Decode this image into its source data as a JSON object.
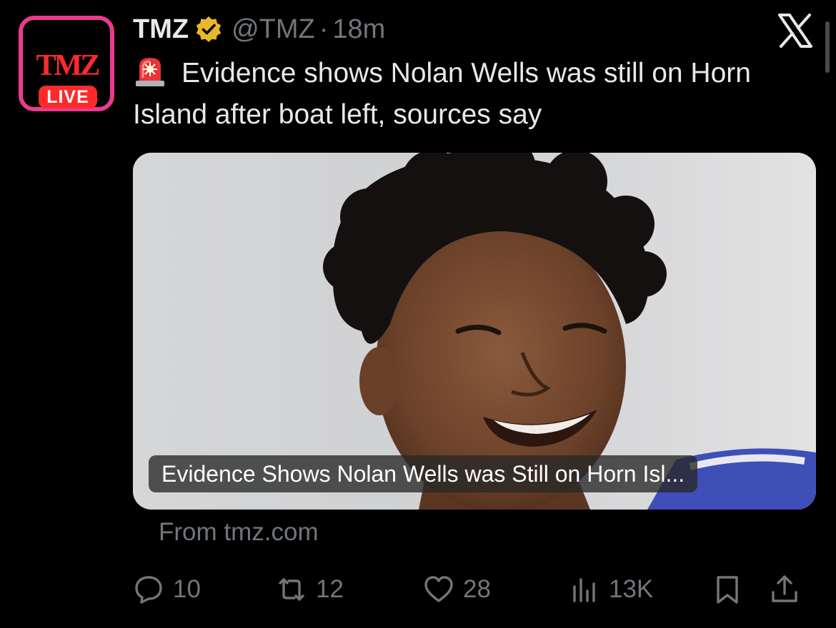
{
  "author": {
    "avatar": {
      "logo_text": "TMZ",
      "live_label": "LIVE",
      "border_color": "#ea3b8d",
      "logo_color": "#ff2a2a"
    },
    "display_name": "TMZ",
    "verified_icon": "gold-verified-badge-icon",
    "handle": "@TMZ",
    "separator": "·",
    "time": "18m"
  },
  "header_icons": {
    "close": "x-logo-icon"
  },
  "post": {
    "emoji": "police-siren-emoji",
    "text": "Evidence shows Nolan Wells was still on Horn Island after boat left, sources say"
  },
  "link_card": {
    "image": "photo of smiling young man with curly hair against light gray background",
    "caption": "Evidence Shows Nolan Wells was Still on Horn Isl...",
    "source": "From tmz.com"
  },
  "actions": {
    "replies": {
      "icon": "reply-bubble-icon",
      "count": "10"
    },
    "reposts": {
      "icon": "repost-arrows-icon",
      "count": "12"
    },
    "likes": {
      "icon": "heart-icon",
      "count": "28"
    },
    "views": {
      "icon": "views-bars-icon",
      "count": "13K"
    },
    "bookmark": {
      "icon": "bookmark-icon"
    },
    "share": {
      "icon": "share-upload-icon"
    }
  },
  "colors": {
    "background": "#000000",
    "primary_text": "#e7e9ea",
    "secondary_text": "#71767b",
    "verified_gold": "#e8b828"
  }
}
